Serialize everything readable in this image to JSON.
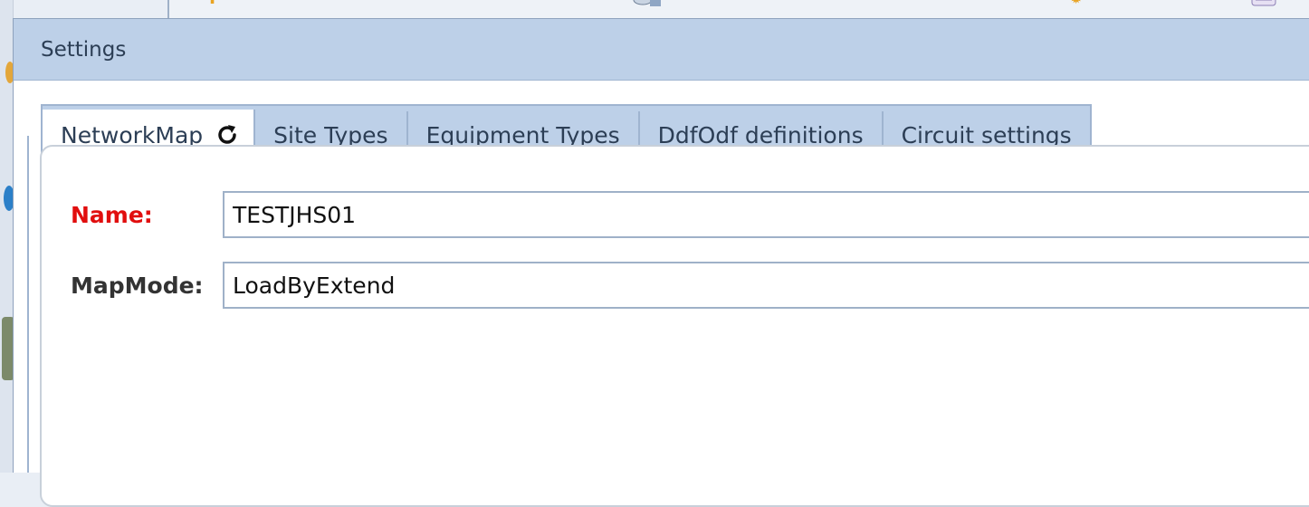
{
  "dialog": {
    "title": "Settings"
  },
  "tabs": [
    {
      "label": "NetworkMap",
      "active": true,
      "icon": "refresh-icon"
    },
    {
      "label": "Site Types",
      "active": false
    },
    {
      "label": "Equipment Types",
      "active": false
    },
    {
      "label": "DdfOdf definitions",
      "active": false
    },
    {
      "label": "Circuit settings",
      "active": false
    }
  ],
  "form": {
    "name_label": "Name:",
    "name_value": "TESTJHS01",
    "mapmode_label": "MapMode:",
    "mapmode_value": "LoadByExtend"
  },
  "colors": {
    "titlebar": "#bdd0e8",
    "tab_inactive": "#bdd0e8",
    "required_label": "#e10e0e",
    "border": "#9fb4d0"
  }
}
